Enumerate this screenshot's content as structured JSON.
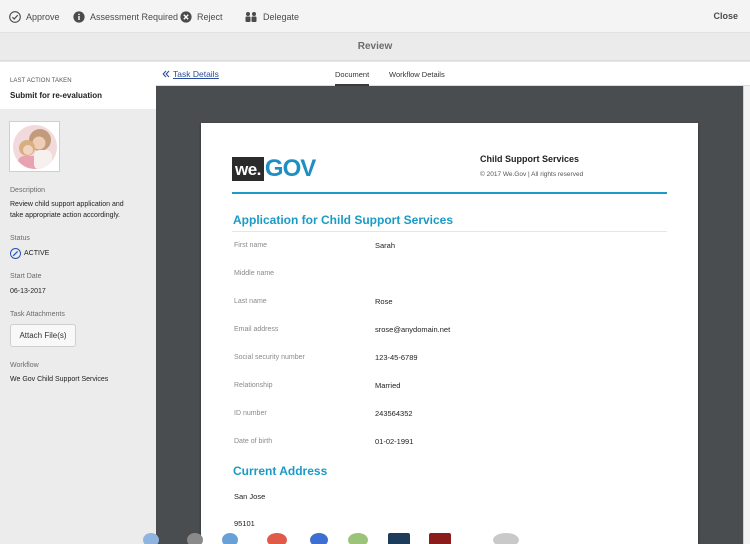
{
  "toolbar": {
    "approve_label": "Approve",
    "assessment_label": "Assessment Required",
    "reject_label": "Reject",
    "delegate_label": "Delegate",
    "close_label": "Close"
  },
  "title": "Review",
  "sidebar": {
    "last_action_label": "LAST ACTION TAKEN",
    "last_action_value": "Submit for re-evaluation",
    "description_label": "Description",
    "description_line1": "Review child support application and",
    "description_line2": "take appropriate action accordingly.",
    "status_label": "Status",
    "status_value": "ACTIVE",
    "start_date_label": "Start Date",
    "start_date_value": "06-13-2017",
    "attachments_label": "Task Attachments",
    "attach_button": "Attach File(s)",
    "workflow_label": "Workflow",
    "workflow_value": "We Gov Child Support Services"
  },
  "content": {
    "back_link": "Task Details",
    "tabs": [
      {
        "label": "Document",
        "active": true
      },
      {
        "label": "Workflow Details",
        "active": false
      }
    ]
  },
  "document": {
    "logo_we": "we.",
    "logo_gov": "GOV",
    "org_title": "Child Support Services",
    "org_copy": "© 2017 We.Gov | All rights reserved",
    "app_title": "Application for Child Support Services",
    "fields": [
      {
        "label": "First name",
        "value": "Sarah"
      },
      {
        "label": "Middle name",
        "value": ""
      },
      {
        "label": "Last name",
        "value": "Rose"
      },
      {
        "label": "Email address",
        "value": "srose@anydomain.net"
      },
      {
        "label": "Social security number",
        "value": "123-45-6789"
      },
      {
        "label": "Relationship",
        "value": "Married"
      },
      {
        "label": "ID number",
        "value": "243564352"
      },
      {
        "label": "Date of birth",
        "value": "01-02-1991"
      }
    ],
    "address_title": "Current Address",
    "address_city": "San Jose",
    "address_zip": "95101"
  },
  "colors": {
    "accent_blue": "#1a9bc5",
    "link_blue": "#2a4d9e",
    "status_blue": "#2053b7",
    "doc_background": "#4a4d50"
  }
}
